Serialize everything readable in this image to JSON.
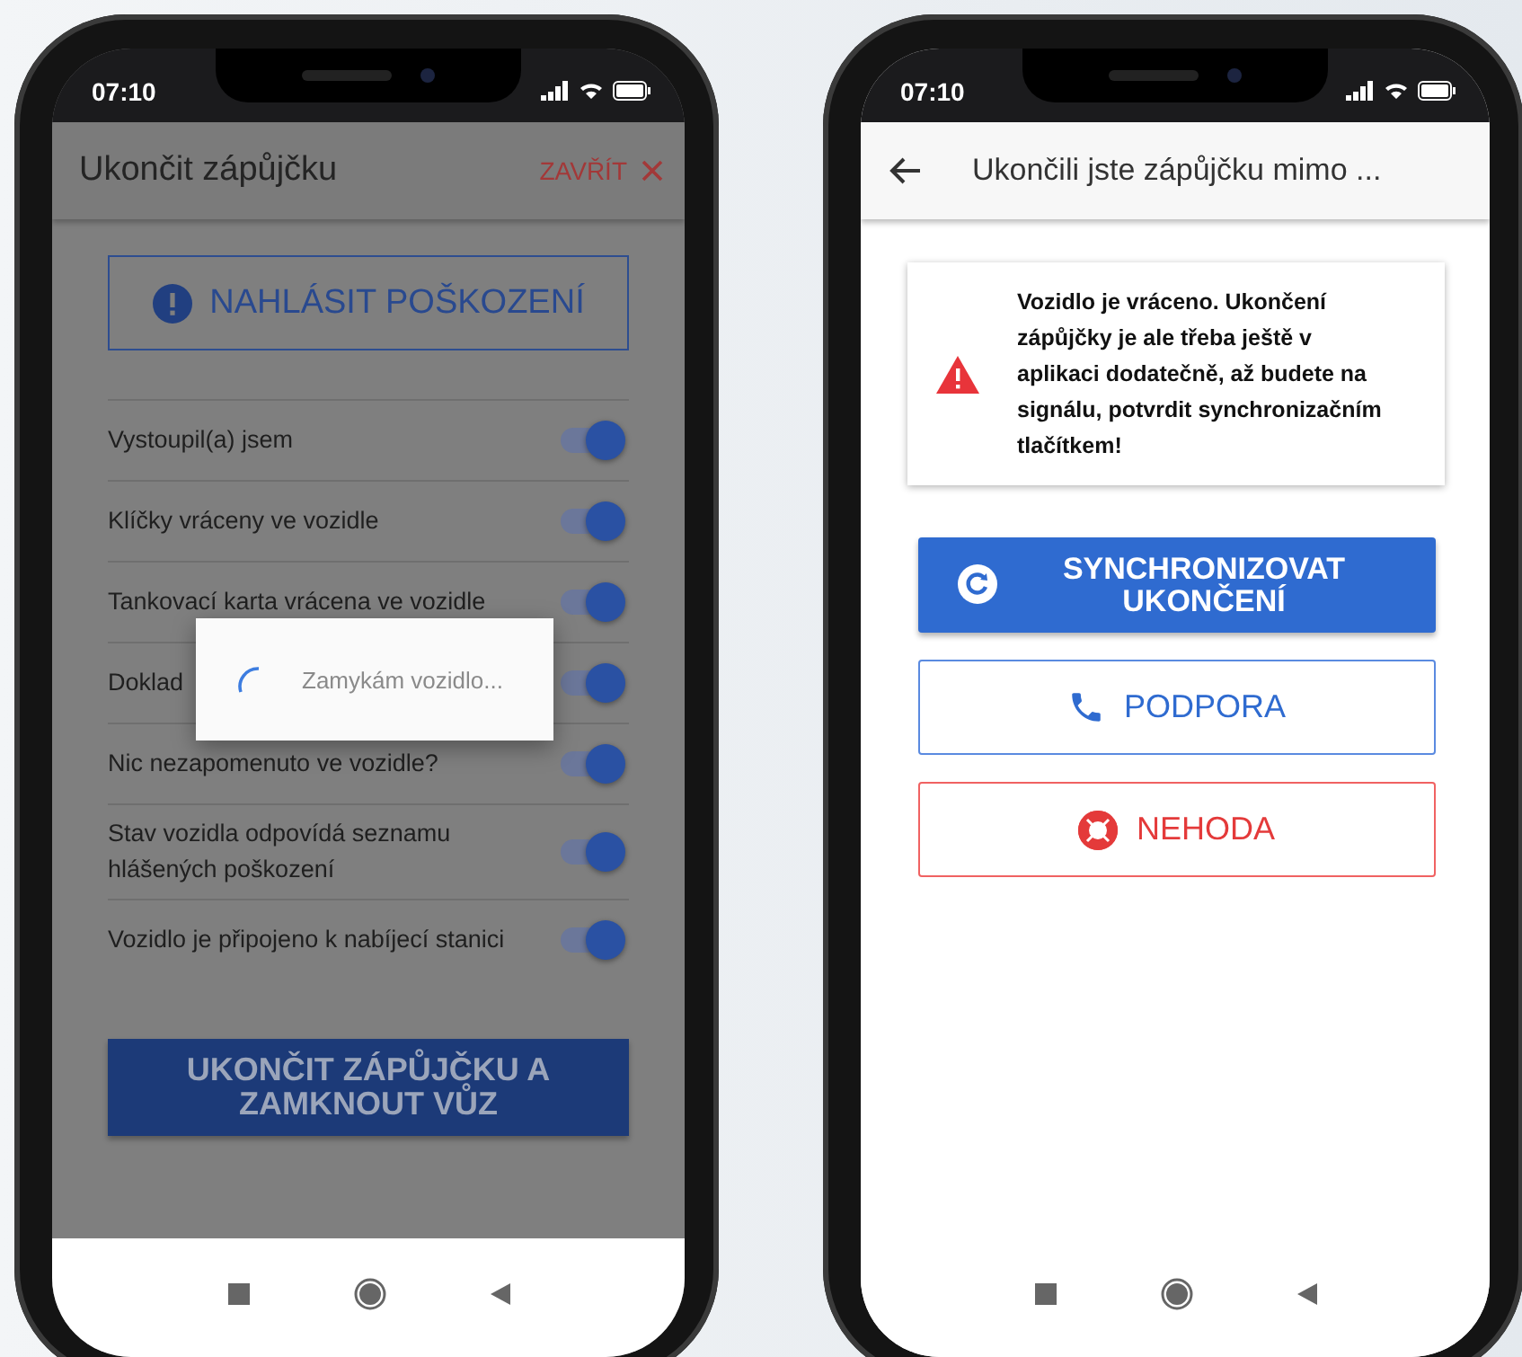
{
  "end_rental_screen": {
    "status_bar": {
      "time": "07:10"
    },
    "header": {
      "title": "Ukončit zápůjčku",
      "close_label": "ZAVŘÍT"
    },
    "report_button": "NAHLÁSIT POŠKOZENÍ",
    "checklist": [
      {
        "label": "Vystoupil(a) jsem",
        "on": true
      },
      {
        "label": "Klíčky vráceny ve vozidle",
        "on": true
      },
      {
        "label": "Tankovací karta vrácena ve vozidle",
        "on": true
      },
      {
        "label": "Doklad",
        "on": true
      },
      {
        "label": "Nic nezapomenuto ve vozidle?",
        "on": true
      },
      {
        "label": "Stav vozidla odpovídá seznamu hlášených poškození",
        "on": true
      },
      {
        "label": "Vozidlo je připojeno k nabíjecí stanici",
        "on": true
      }
    ],
    "submit_button": "UKONČIT ZÁPŮJČKU A ZAMKNOUT VŮZ",
    "loading_dialog": {
      "text": "Zamykám vozidlo..."
    }
  },
  "sync_screen": {
    "status_bar": {
      "time": "07:10"
    },
    "header": {
      "title": "Ukončili jste zápůjčku mimo ..."
    },
    "warning": "Vozidlo je vráceno. Ukončení zápůjčky je ale třeba ještě v aplikaci dodatečně, až budete na signálu, potvrdit synchronizačním tlačítkem!",
    "buttons": [
      {
        "kind": "sync",
        "label": "SYNCHRONIZOVAT UKONČENÍ"
      },
      {
        "kind": "support",
        "label": "PODPORA"
      },
      {
        "kind": "accident",
        "label": "NEHODA"
      }
    ]
  }
}
